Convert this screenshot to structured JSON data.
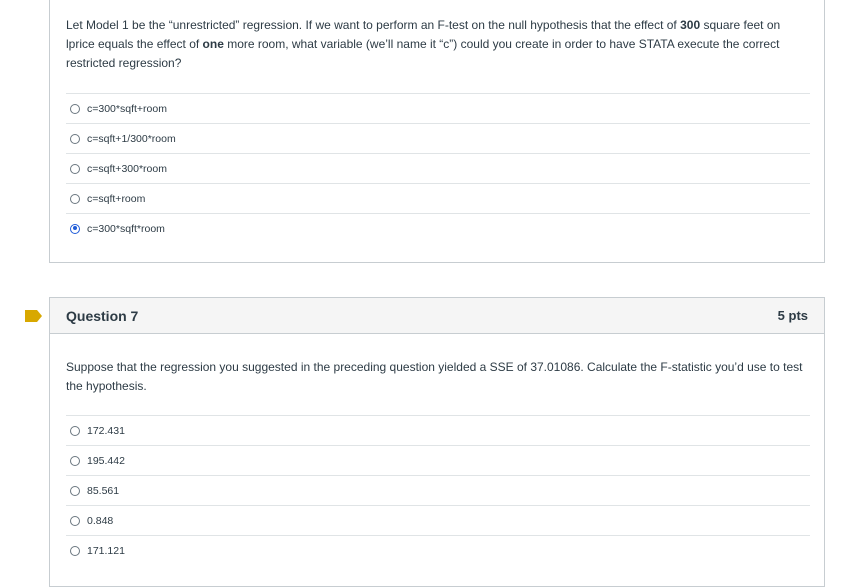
{
  "question6": {
    "text_parts": [
      {
        "t": "Let Model 1 be the “unrestricted” regression.  If we want to perform an F-test on the null hypothesis that the effect of ",
        "bold": false
      },
      {
        "t": "300",
        "bold": true
      },
      {
        "t": " square feet on lprice equals the effect of ",
        "bold": false
      },
      {
        "t": "one",
        "bold": true
      },
      {
        "t": " more room, what variable (we’ll name it “c”) could you create in order to have STATA execute the correct restricted regression?",
        "bold": false
      }
    ],
    "answers": [
      {
        "label": "c=300*sqft+room",
        "selected": false
      },
      {
        "label": "c=sqft+1/300*room",
        "selected": false
      },
      {
        "label": "c=sqft+300*room",
        "selected": false
      },
      {
        "label": "c=sqft+room",
        "selected": false
      },
      {
        "label": "c=300*sqft*room",
        "selected": true
      }
    ]
  },
  "question7": {
    "title": "Question 7",
    "points": "5 pts",
    "text": "Suppose that the regression you suggested in the preceding question yielded a SSE of 37.01086.  Calculate the F-statistic you’d use to test the hypothesis.",
    "answers": [
      {
        "label": "172.431",
        "selected": false
      },
      {
        "label": "195.442",
        "selected": false
      },
      {
        "label": "85.561",
        "selected": false
      },
      {
        "label": "0.848",
        "selected": false
      },
      {
        "label": "171.121",
        "selected": false
      }
    ]
  },
  "colors": {
    "flag": "#d8a800",
    "radio_selected": "#1f5bd8",
    "border": "#c7cdd1",
    "text": "#2d3b45"
  },
  "icons": {
    "flag": "bookmark-flag-icon"
  }
}
